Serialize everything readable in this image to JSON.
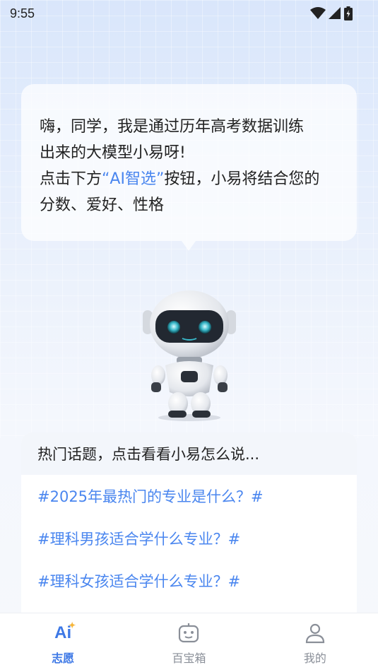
{
  "status_bar": {
    "time": "9:55"
  },
  "bubble": {
    "line1": "嗨，同学，我是通过历年高考数据训练",
    "line2": "出来的大模型小易呀!",
    "line3_prefix": "点击下方",
    "line3_highlight": "“AI智选”",
    "line3_suffix": "按钮，小易将结合您的",
    "line4": "分数、爱好、性格"
  },
  "topics": {
    "header": "热门话题，点击看看小易怎么说...",
    "items": [
      {
        "label": "#2025年最热门的专业是什么？#"
      },
      {
        "label": "#理科男孩适合学什么专业？#"
      },
      {
        "label": "#理科女孩适合学什么专业？#"
      }
    ]
  },
  "tab_bar": {
    "tabs": [
      {
        "label": "志愿",
        "icon": "ai-icon",
        "active": true
      },
      {
        "label": "百宝箱",
        "icon": "robot-box-icon",
        "active": false
      },
      {
        "label": "我的",
        "icon": "person-icon",
        "active": false
      }
    ],
    "ai_glyph": "Ai"
  },
  "colors": {
    "accent": "#4a86ef",
    "active_tab": "#3d78e6",
    "inactive_tab": "#8a8f98"
  }
}
